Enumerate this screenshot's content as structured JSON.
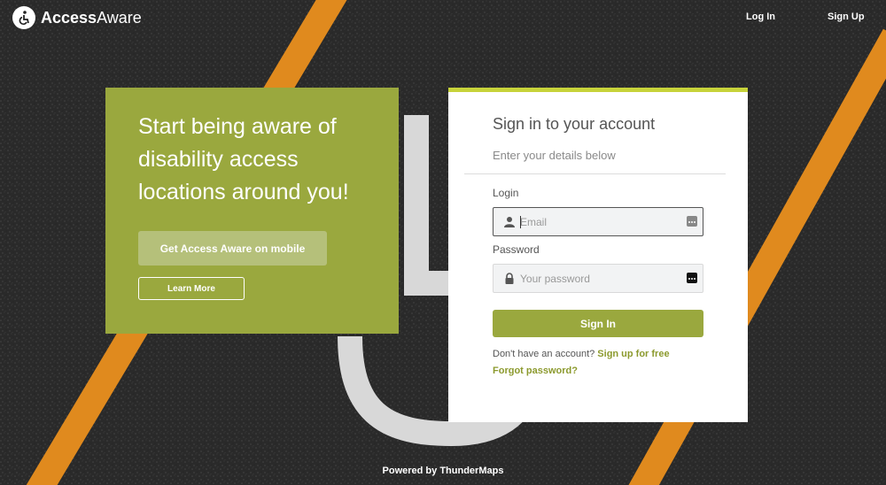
{
  "brand": {
    "name_bold": "Access",
    "name_regular": "Aware",
    "logo_icon": "wheelchair-location-icon"
  },
  "nav": {
    "login": "Log In",
    "signup": "Sign Up"
  },
  "promo": {
    "title": "Start being aware of disability access locations around you!",
    "mobile_button": "Get Access Aware on mobile",
    "learn_button": "Learn More"
  },
  "card": {
    "title": "Sign in to your account",
    "subtitle": "Enter your details below",
    "login_label": "Login",
    "email_placeholder": "Email",
    "password_label": "Password",
    "password_placeholder": "Your password",
    "signin_button": "Sign In",
    "no_account_text": "Don't have an account?",
    "signup_link": "Sign up for free",
    "forgot_link": "Forgot password?"
  },
  "footer": {
    "text": "Powered by ThunderMaps"
  },
  "colors": {
    "accent": "#9aa83e",
    "accent_top_border": "#c7d33a",
    "asphalt": "#2b2b2b",
    "road_line": "#e08a1e"
  }
}
